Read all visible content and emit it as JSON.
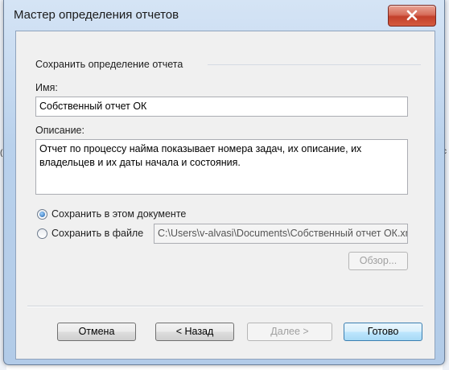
{
  "window": {
    "title": "Мастер определения отчетов"
  },
  "section": {
    "title": "Сохранить определение отчета"
  },
  "name_field": {
    "label": "Имя:",
    "value": "Собственный отчет ОК"
  },
  "description_field": {
    "label": "Описание:",
    "value": "Отчет по процессу найма показывает номера задач, их описание, их владельцев и их даты начала и состояния."
  },
  "save_options": {
    "in_document_label": "Сохранить в этом документе",
    "in_file_label": "Сохранить в файле",
    "selected": "in_document",
    "file_path": "C:\\Users\\v-alvasi\\Documents\\Собственный отчет ОК.xml",
    "browse_label": "Обзор..."
  },
  "footer": {
    "cancel_label": "Отмена",
    "back_label": "< Назад",
    "next_label": "Далее >",
    "finish_label": "Готово"
  },
  "background": {
    "cell_left": "(",
    "cell_right": "с"
  },
  "colors": {
    "close_button": "#c3402a",
    "radio_selected": "#1f5fa8",
    "default_button_border": "#3c7fb1"
  }
}
